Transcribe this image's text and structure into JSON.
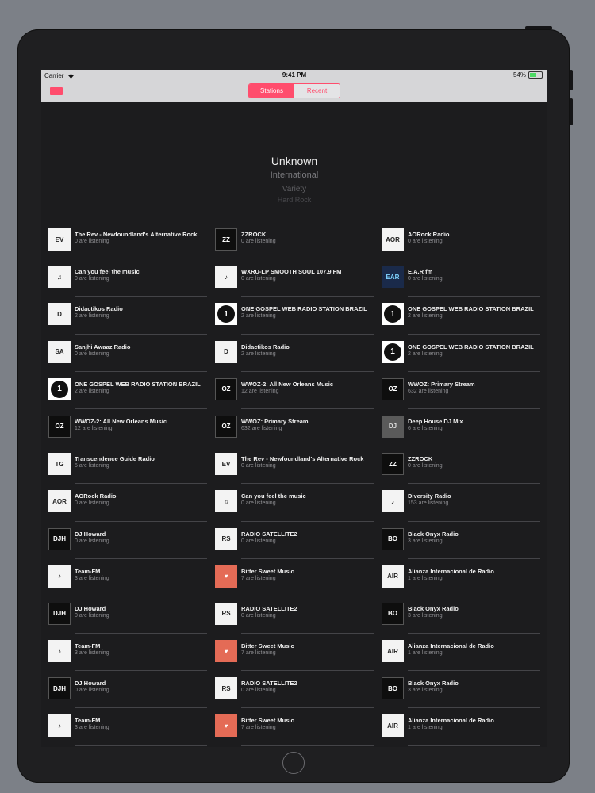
{
  "status_bar": {
    "carrier": "Carrier",
    "time": "9:41 PM",
    "battery_label": "54%",
    "battery_level": 0.54
  },
  "nav": {
    "segments": [
      {
        "label": "Stations",
        "active": true
      },
      {
        "label": "Recent",
        "active": false
      }
    ]
  },
  "genres": {
    "selected": "Unknown",
    "items": [
      "International",
      "Variety",
      "Hard Rock"
    ]
  },
  "stations": [
    {
      "name": "The Rev - Newfoundland's Alternative Rock",
      "listeners": "0 are listening",
      "thumb": "EV",
      "style": "t-light"
    },
    {
      "name": "ZZROCK",
      "listeners": "0 are listening",
      "thumb": "ZZ",
      "style": "t-dark"
    },
    {
      "name": "AORock Radio",
      "listeners": "0 are listening",
      "thumb": "AOR",
      "style": "t-light"
    },
    {
      "name": "Can you feel the music",
      "listeners": "0 are listening",
      "thumb": "♫",
      "style": "t-light"
    },
    {
      "name": "WXRU-LP SMOOTH SOUL 107.9 FM",
      "listeners": "0 are listening",
      "thumb": "♪",
      "style": "t-light"
    },
    {
      "name": "E.A.R fm",
      "listeners": "0 are listening",
      "thumb": "EAR",
      "style": "t-blue"
    },
    {
      "name": "Didactikos Radio",
      "listeners": "2 are listening",
      "thumb": "D",
      "style": "t-light"
    },
    {
      "name": "ONE GOSPEL WEB RADIO STATION BRAZIL",
      "listeners": "2 are listening",
      "thumb": "1",
      "style": "t-circle"
    },
    {
      "name": "ONE GOSPEL WEB RADIO STATION BRAZIL",
      "listeners": "2 are listening",
      "thumb": "1",
      "style": "t-circle"
    },
    {
      "name": "Sanjhi Awaaz Radio",
      "listeners": "0 are listening",
      "thumb": "SA",
      "style": "t-light"
    },
    {
      "name": "Didactikos Radio",
      "listeners": "2 are listening",
      "thumb": "D",
      "style": "t-light"
    },
    {
      "name": "ONE GOSPEL WEB RADIO STATION BRAZIL",
      "listeners": "2 are listening",
      "thumb": "1",
      "style": "t-circle"
    },
    {
      "name": "ONE GOSPEL WEB RADIO STATION BRAZIL",
      "listeners": "2 are listening",
      "thumb": "1",
      "style": "t-circle"
    },
    {
      "name": "WWOZ-2: All New Orleans Music",
      "listeners": "12 are listening",
      "thumb": "OZ",
      "style": "t-dark"
    },
    {
      "name": "WWOZ: Primary Stream",
      "listeners": "632 are listening",
      "thumb": "OZ",
      "style": "t-dark"
    },
    {
      "name": "WWOZ-2: All New Orleans Music",
      "listeners": "12 are listening",
      "thumb": "OZ",
      "style": "t-dark"
    },
    {
      "name": "WWOZ: Primary Stream",
      "listeners": "632 are listening",
      "thumb": "OZ",
      "style": "t-dark"
    },
    {
      "name": "Deep House DJ Mix",
      "listeners": "6 are listening",
      "thumb": "DJ",
      "style": "t-photo"
    },
    {
      "name": "Transcendence Guide Radio",
      "listeners": "5 are listening",
      "thumb": "TG",
      "style": "t-light"
    },
    {
      "name": "The Rev - Newfoundland's Alternative Rock",
      "listeners": "0 are listening",
      "thumb": "EV",
      "style": "t-light"
    },
    {
      "name": "ZZROCK",
      "listeners": "0 are listening",
      "thumb": "ZZ",
      "style": "t-dark"
    },
    {
      "name": "AORock Radio",
      "listeners": "0 are listening",
      "thumb": "AOR",
      "style": "t-light"
    },
    {
      "name": "Can you feel the music",
      "listeners": "0 are listening",
      "thumb": "♫",
      "style": "t-light"
    },
    {
      "name": "Diversity Radio",
      "listeners": "153 are listening",
      "thumb": "♪",
      "style": "t-light"
    },
    {
      "name": "DJ Howard",
      "listeners": "0 are listening",
      "thumb": "DJH",
      "style": "t-dark"
    },
    {
      "name": "RADIO SATELLITE2",
      "listeners": "0 are listening",
      "thumb": "RS",
      "style": "t-light"
    },
    {
      "name": "Black Onyx Radio",
      "listeners": "3 are listening",
      "thumb": "BO",
      "style": "t-dark"
    },
    {
      "name": "Team-FM",
      "listeners": "3 are listening",
      "thumb": "♪",
      "style": "t-light"
    },
    {
      "name": "Bitter Sweet Music",
      "listeners": "7 are listening",
      "thumb": "♥",
      "style": "t-red"
    },
    {
      "name": "Alianza Internacional de Radio",
      "listeners": "1 are listening",
      "thumb": "AIR",
      "style": "t-light"
    },
    {
      "name": "DJ Howard",
      "listeners": "0 are listening",
      "thumb": "DJH",
      "style": "t-dark"
    },
    {
      "name": "RADIO SATELLITE2",
      "listeners": "0 are listening",
      "thumb": "RS",
      "style": "t-light"
    },
    {
      "name": "Black Onyx Radio",
      "listeners": "3 are listening",
      "thumb": "BO",
      "style": "t-dark"
    },
    {
      "name": "Team-FM",
      "listeners": "3 are listening",
      "thumb": "♪",
      "style": "t-light"
    },
    {
      "name": "Bitter Sweet Music",
      "listeners": "7 are listening",
      "thumb": "♥",
      "style": "t-red"
    },
    {
      "name": "Alianza Internacional de Radio",
      "listeners": "1 are listening",
      "thumb": "AIR",
      "style": "t-light"
    },
    {
      "name": "DJ Howard",
      "listeners": "0 are listening",
      "thumb": "DJH",
      "style": "t-dark"
    },
    {
      "name": "RADIO SATELLITE2",
      "listeners": "0 are listening",
      "thumb": "RS",
      "style": "t-light"
    },
    {
      "name": "Black Onyx Radio",
      "listeners": "3 are listening",
      "thumb": "BO",
      "style": "t-dark"
    },
    {
      "name": "Team-FM",
      "listeners": "3 are listening",
      "thumb": "♪",
      "style": "t-light"
    },
    {
      "name": "Bitter Sweet Music",
      "listeners": "7 are listening",
      "thumb": "♥",
      "style": "t-red"
    },
    {
      "name": "Alianza Internacional de Radio",
      "listeners": "1 are listening",
      "thumb": "AIR",
      "style": "t-light"
    }
  ],
  "colors": {
    "accent": "#ff4d6d",
    "background": "#1c1c1e",
    "device": "#1f1f21"
  },
  "icons": {
    "menu": "menu-icon",
    "wifi": "wifi-icon",
    "battery": "battery-icon",
    "home": "home-button"
  }
}
